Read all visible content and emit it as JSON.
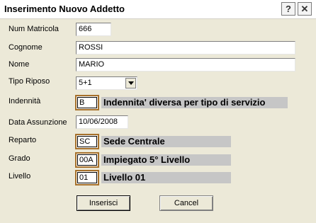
{
  "window": {
    "title": "Inserimento Nuovo Addetto",
    "help_glyph": "?",
    "close_glyph": "✕"
  },
  "fields": {
    "matricola": {
      "label": "Num Matricola",
      "value": "666"
    },
    "cognome": {
      "label": "Cognome",
      "value": "ROSSI"
    },
    "nome": {
      "label": "Nome",
      "value": "MARIO"
    },
    "tipo_riposo": {
      "label": "Tipo Riposo",
      "value": "5+1"
    },
    "indennita": {
      "label": "Indennità",
      "code": "B",
      "desc": "Indennita' diversa per tipo di servizio"
    },
    "data_assunzione": {
      "label": "Data Assunzione",
      "value": "10/06/2008"
    },
    "reparto": {
      "label": "Reparto",
      "code": "SC",
      "desc": "Sede Centrale"
    },
    "grado": {
      "label": "Grado",
      "code": "00A",
      "desc": "Impiegato 5° Livello"
    },
    "livello": {
      "label": "Livello",
      "code": "01",
      "desc": "Livello 01"
    }
  },
  "buttons": {
    "inserisci": "Inserisci",
    "cancel": "Cancel"
  },
  "icons": {
    "help": "help-icon",
    "close": "close-icon",
    "dropdown": "chevron-down-icon"
  }
}
